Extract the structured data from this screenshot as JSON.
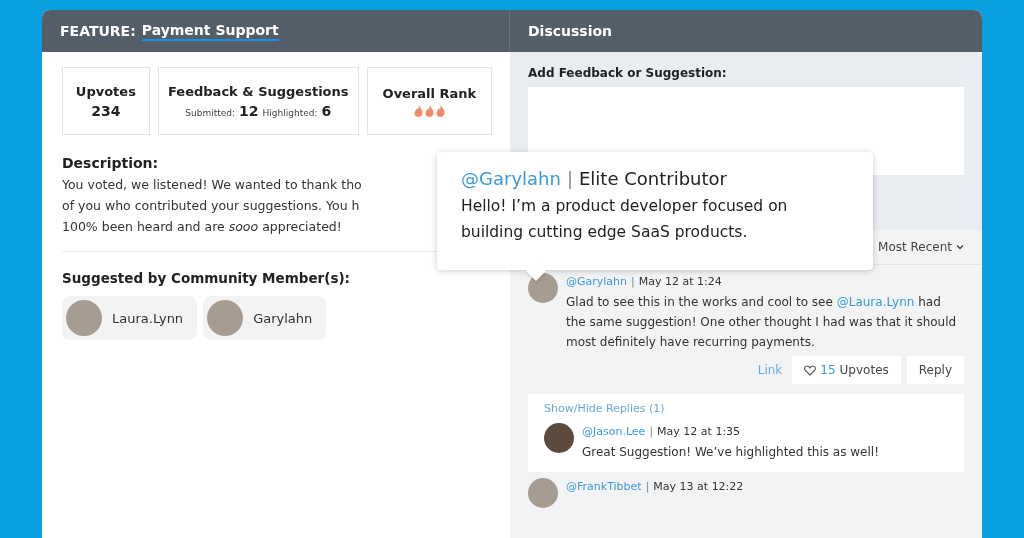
{
  "header": {
    "feature_label": "FEATURE:",
    "feature_name": "Payment Support",
    "discussion_title": "Discussion"
  },
  "stats": {
    "upvotes": {
      "label": "Upvotes",
      "value": "234"
    },
    "feedback": {
      "label": "Feedback & Suggestions",
      "submitted_label": "Submitted:",
      "submitted": "12",
      "highlighted_label": "Highlighted:",
      "highlighted": "6"
    },
    "rank": {
      "label": "Overall Rank",
      "stars": 3
    }
  },
  "description": {
    "title": "Description:",
    "lines": [
      "You voted, we listened! We wanted to thank tho",
      "of you who contributed your suggestions. You h",
      "100% been heard and are *sooo* appreciated!"
    ]
  },
  "members": {
    "title": "Suggested by Community Member(s):",
    "items": [
      {
        "name": "Laura.Lynn"
      },
      {
        "name": "Garylahn"
      }
    ]
  },
  "tooltip": {
    "handle": "@Garylahn",
    "separator": "|",
    "role": "Elite Contributor",
    "bio": "Hello! I’m a product developer focused on building cutting edge SaaS products."
  },
  "feedback_form": {
    "label": "Add Feedback or Suggestion:"
  },
  "sort": {
    "value": "Most Recent"
  },
  "comments": [
    {
      "handle": "@Garylahn",
      "separator": "|",
      "date": "May 12 at 1:24",
      "text_before": "Glad to see this in the works and cool to see",
      "mention": "@Laura.Lynn",
      "text_after": "had the same suggestion! One other thought I had was that it should most definitely have recurring payments.",
      "link": "Link",
      "upvote_count": "15",
      "upvote_label": "Upvotes",
      "reply": "Reply",
      "replies_toggle": "Show/Hide Replies (1)",
      "replies": [
        {
          "handle": "@Jason.Lee",
          "separator": "|",
          "date": "May 12 at 1:35",
          "text": "Great Suggestion! We’ve highlighted this as well!"
        }
      ]
    },
    {
      "handle": "@FrankTibbet",
      "separator": "|",
      "date": "May 13 at 12:22"
    }
  ]
}
